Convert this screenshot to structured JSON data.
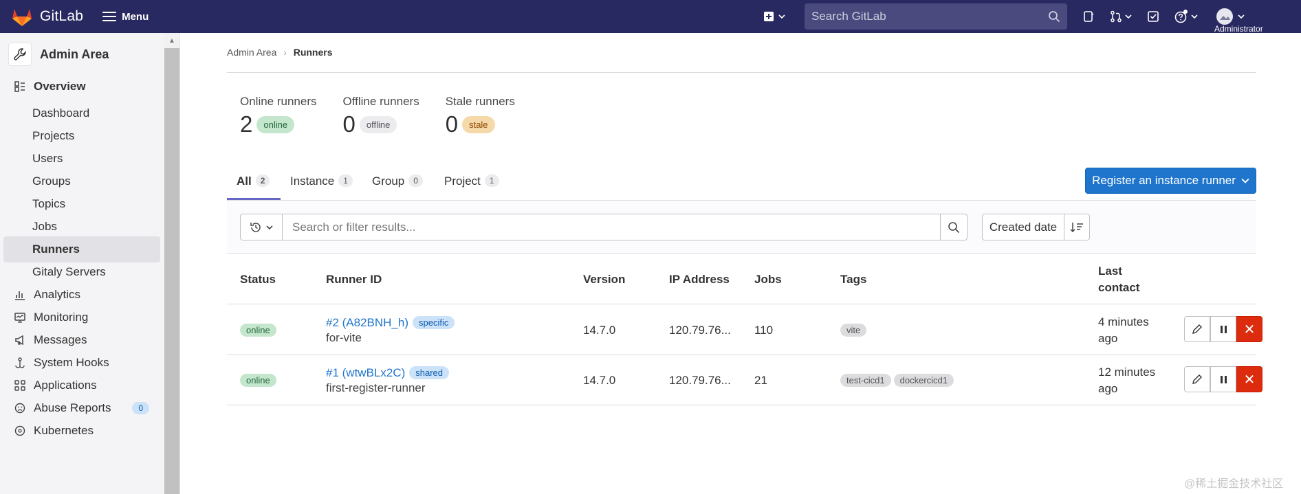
{
  "topbar": {
    "app_name": "GitLab",
    "menu_label": "Menu",
    "search_placeholder": "Search GitLab",
    "user_label": "Administrator",
    "brand_color": "#292961"
  },
  "sidebar": {
    "context_title": "Admin Area",
    "items": [
      {
        "label": "Overview",
        "icon": "overview-icon"
      },
      {
        "label": "Dashboard"
      },
      {
        "label": "Projects"
      },
      {
        "label": "Users"
      },
      {
        "label": "Groups"
      },
      {
        "label": "Topics"
      },
      {
        "label": "Jobs"
      },
      {
        "label": "Runners",
        "active": true
      },
      {
        "label": "Gitaly Servers"
      },
      {
        "label": "Analytics",
        "icon": "analytics-icon"
      },
      {
        "label": "Monitoring",
        "icon": "monitor-icon"
      },
      {
        "label": "Messages",
        "icon": "megaphone-icon"
      },
      {
        "label": "System Hooks",
        "icon": "hook-icon"
      },
      {
        "label": "Applications",
        "icon": "applications-icon"
      },
      {
        "label": "Abuse Reports",
        "icon": "abuse-icon",
        "badge": "0"
      },
      {
        "label": "Kubernetes",
        "icon": "kubernetes-icon"
      }
    ]
  },
  "breadcrumb": {
    "parent": "Admin Area",
    "current": "Runners"
  },
  "stats": [
    {
      "label": "Online runners",
      "value": "2",
      "badge": "online"
    },
    {
      "label": "Offline runners",
      "value": "0",
      "badge": "offline"
    },
    {
      "label": "Stale runners",
      "value": "0",
      "badge": "stale"
    }
  ],
  "tabs": [
    {
      "label": "All",
      "count": "2",
      "active": true
    },
    {
      "label": "Instance",
      "count": "1"
    },
    {
      "label": "Group",
      "count": "0"
    },
    {
      "label": "Project",
      "count": "1"
    }
  ],
  "register_button": "Register an instance runner",
  "filter": {
    "placeholder": "Search or filter results...",
    "sort_label": "Created date"
  },
  "table": {
    "headers": {
      "status": "Status",
      "runner_id": "Runner ID",
      "version": "Version",
      "ip": "IP Address",
      "jobs": "Jobs",
      "tags": "Tags",
      "last_contact_1": "Last",
      "last_contact_2": "contact"
    },
    "rows": [
      {
        "status": "online",
        "id": "#2 (A82BNH_h)",
        "type": "specific",
        "description": "for-vite",
        "version": "14.7.0",
        "ip": "120.79.76...",
        "jobs": "110",
        "tags": [
          "vite"
        ],
        "contact_1": "4 minutes",
        "contact_2": "ago"
      },
      {
        "status": "online",
        "id": "#1 (wtwBLx2C)",
        "type": "shared",
        "description": "first-register-runner",
        "version": "14.7.0",
        "ip": "120.79.76...",
        "jobs": "21",
        "tags": [
          "test-cicd1",
          "dockercicd1"
        ],
        "contact_1": "12 minutes",
        "contact_2": "ago"
      }
    ]
  },
  "watermark": "@稀土掘金技术社区"
}
